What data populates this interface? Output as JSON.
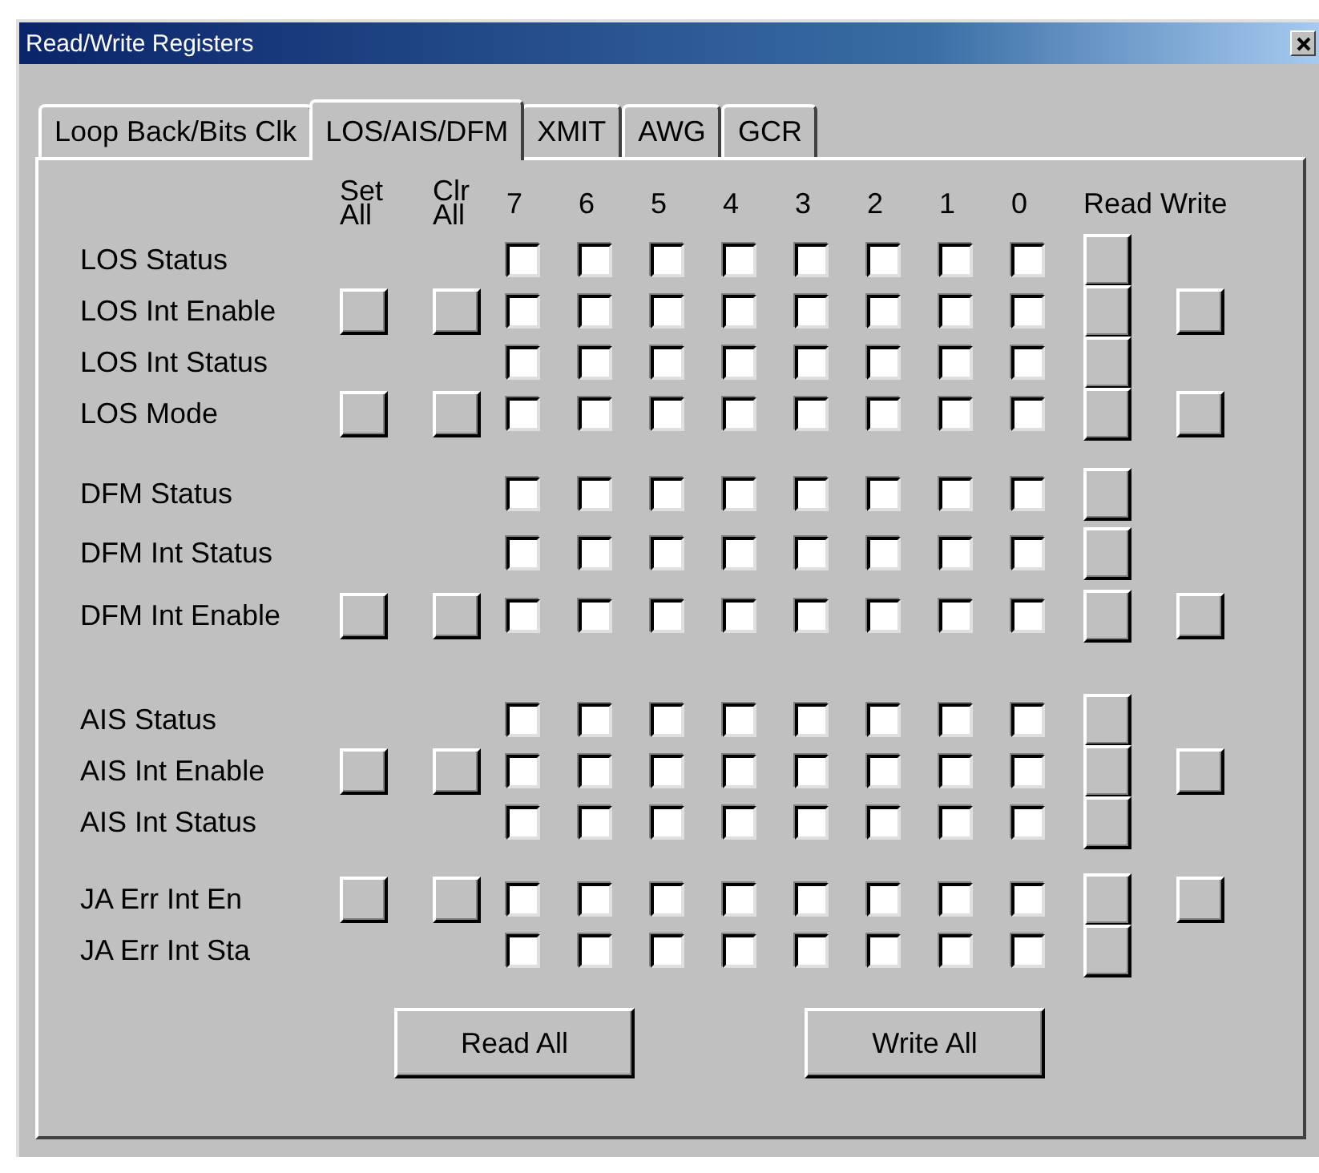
{
  "window": {
    "title": "Read/Write Registers"
  },
  "tabs": [
    {
      "label": "Loop Back/Bits Clk",
      "selected": false
    },
    {
      "label": "LOS/AIS/DFM",
      "selected": true
    },
    {
      "label": "XMIT",
      "selected": false
    },
    {
      "label": "AWG",
      "selected": false
    },
    {
      "label": "GCR",
      "selected": false
    }
  ],
  "header": {
    "set_all": "Set All",
    "clr_all": "Clr All",
    "bits": [
      "7",
      "6",
      "5",
      "4",
      "3",
      "2",
      "1",
      "0"
    ],
    "read": "Read",
    "write": "Write"
  },
  "groups": [
    {
      "rows": [
        {
          "label": "LOS Status",
          "set_clr": false,
          "write": false,
          "bits": [
            false,
            false,
            false,
            false,
            false,
            false,
            false,
            false
          ]
        },
        {
          "label": "LOS Int Enable",
          "set_clr": true,
          "write": true,
          "bits": [
            false,
            false,
            false,
            false,
            false,
            false,
            false,
            false
          ]
        },
        {
          "label": "LOS Int Status",
          "set_clr": false,
          "write": false,
          "bits": [
            false,
            false,
            false,
            false,
            false,
            false,
            false,
            false
          ]
        },
        {
          "label": "LOS Mode",
          "set_clr": true,
          "write": true,
          "bits": [
            false,
            false,
            false,
            false,
            false,
            false,
            false,
            false
          ]
        }
      ]
    },
    {
      "rows": [
        {
          "label": "DFM Status",
          "set_clr": false,
          "write": false,
          "bits": [
            false,
            false,
            false,
            false,
            false,
            false,
            false,
            false
          ]
        },
        {
          "label": "DFM Int Status",
          "set_clr": false,
          "write": false,
          "bits": [
            false,
            false,
            false,
            false,
            false,
            false,
            false,
            false
          ]
        },
        {
          "label": "DFM Int Enable",
          "set_clr": true,
          "write": true,
          "bits": [
            false,
            false,
            false,
            false,
            false,
            false,
            false,
            false
          ]
        }
      ]
    },
    {
      "rows": [
        {
          "label": "AIS Status",
          "set_clr": false,
          "write": false,
          "bits": [
            false,
            false,
            false,
            false,
            false,
            false,
            false,
            false
          ]
        },
        {
          "label": "AIS Int Enable",
          "set_clr": true,
          "write": true,
          "bits": [
            false,
            false,
            false,
            false,
            false,
            false,
            false,
            false
          ]
        },
        {
          "label": "AIS Int Status",
          "set_clr": false,
          "write": false,
          "bits": [
            false,
            false,
            false,
            false,
            false,
            false,
            false,
            false
          ]
        }
      ]
    },
    {
      "rows": [
        {
          "label": "JA Err Int En",
          "set_clr": true,
          "write": true,
          "bits": [
            false,
            false,
            false,
            false,
            false,
            false,
            false,
            false
          ]
        },
        {
          "label": "JA Err Int Sta",
          "set_clr": false,
          "write": false,
          "bits": [
            false,
            false,
            false,
            false,
            false,
            false,
            false,
            false
          ]
        }
      ]
    }
  ],
  "buttons": [
    "Read All",
    "Write All"
  ]
}
